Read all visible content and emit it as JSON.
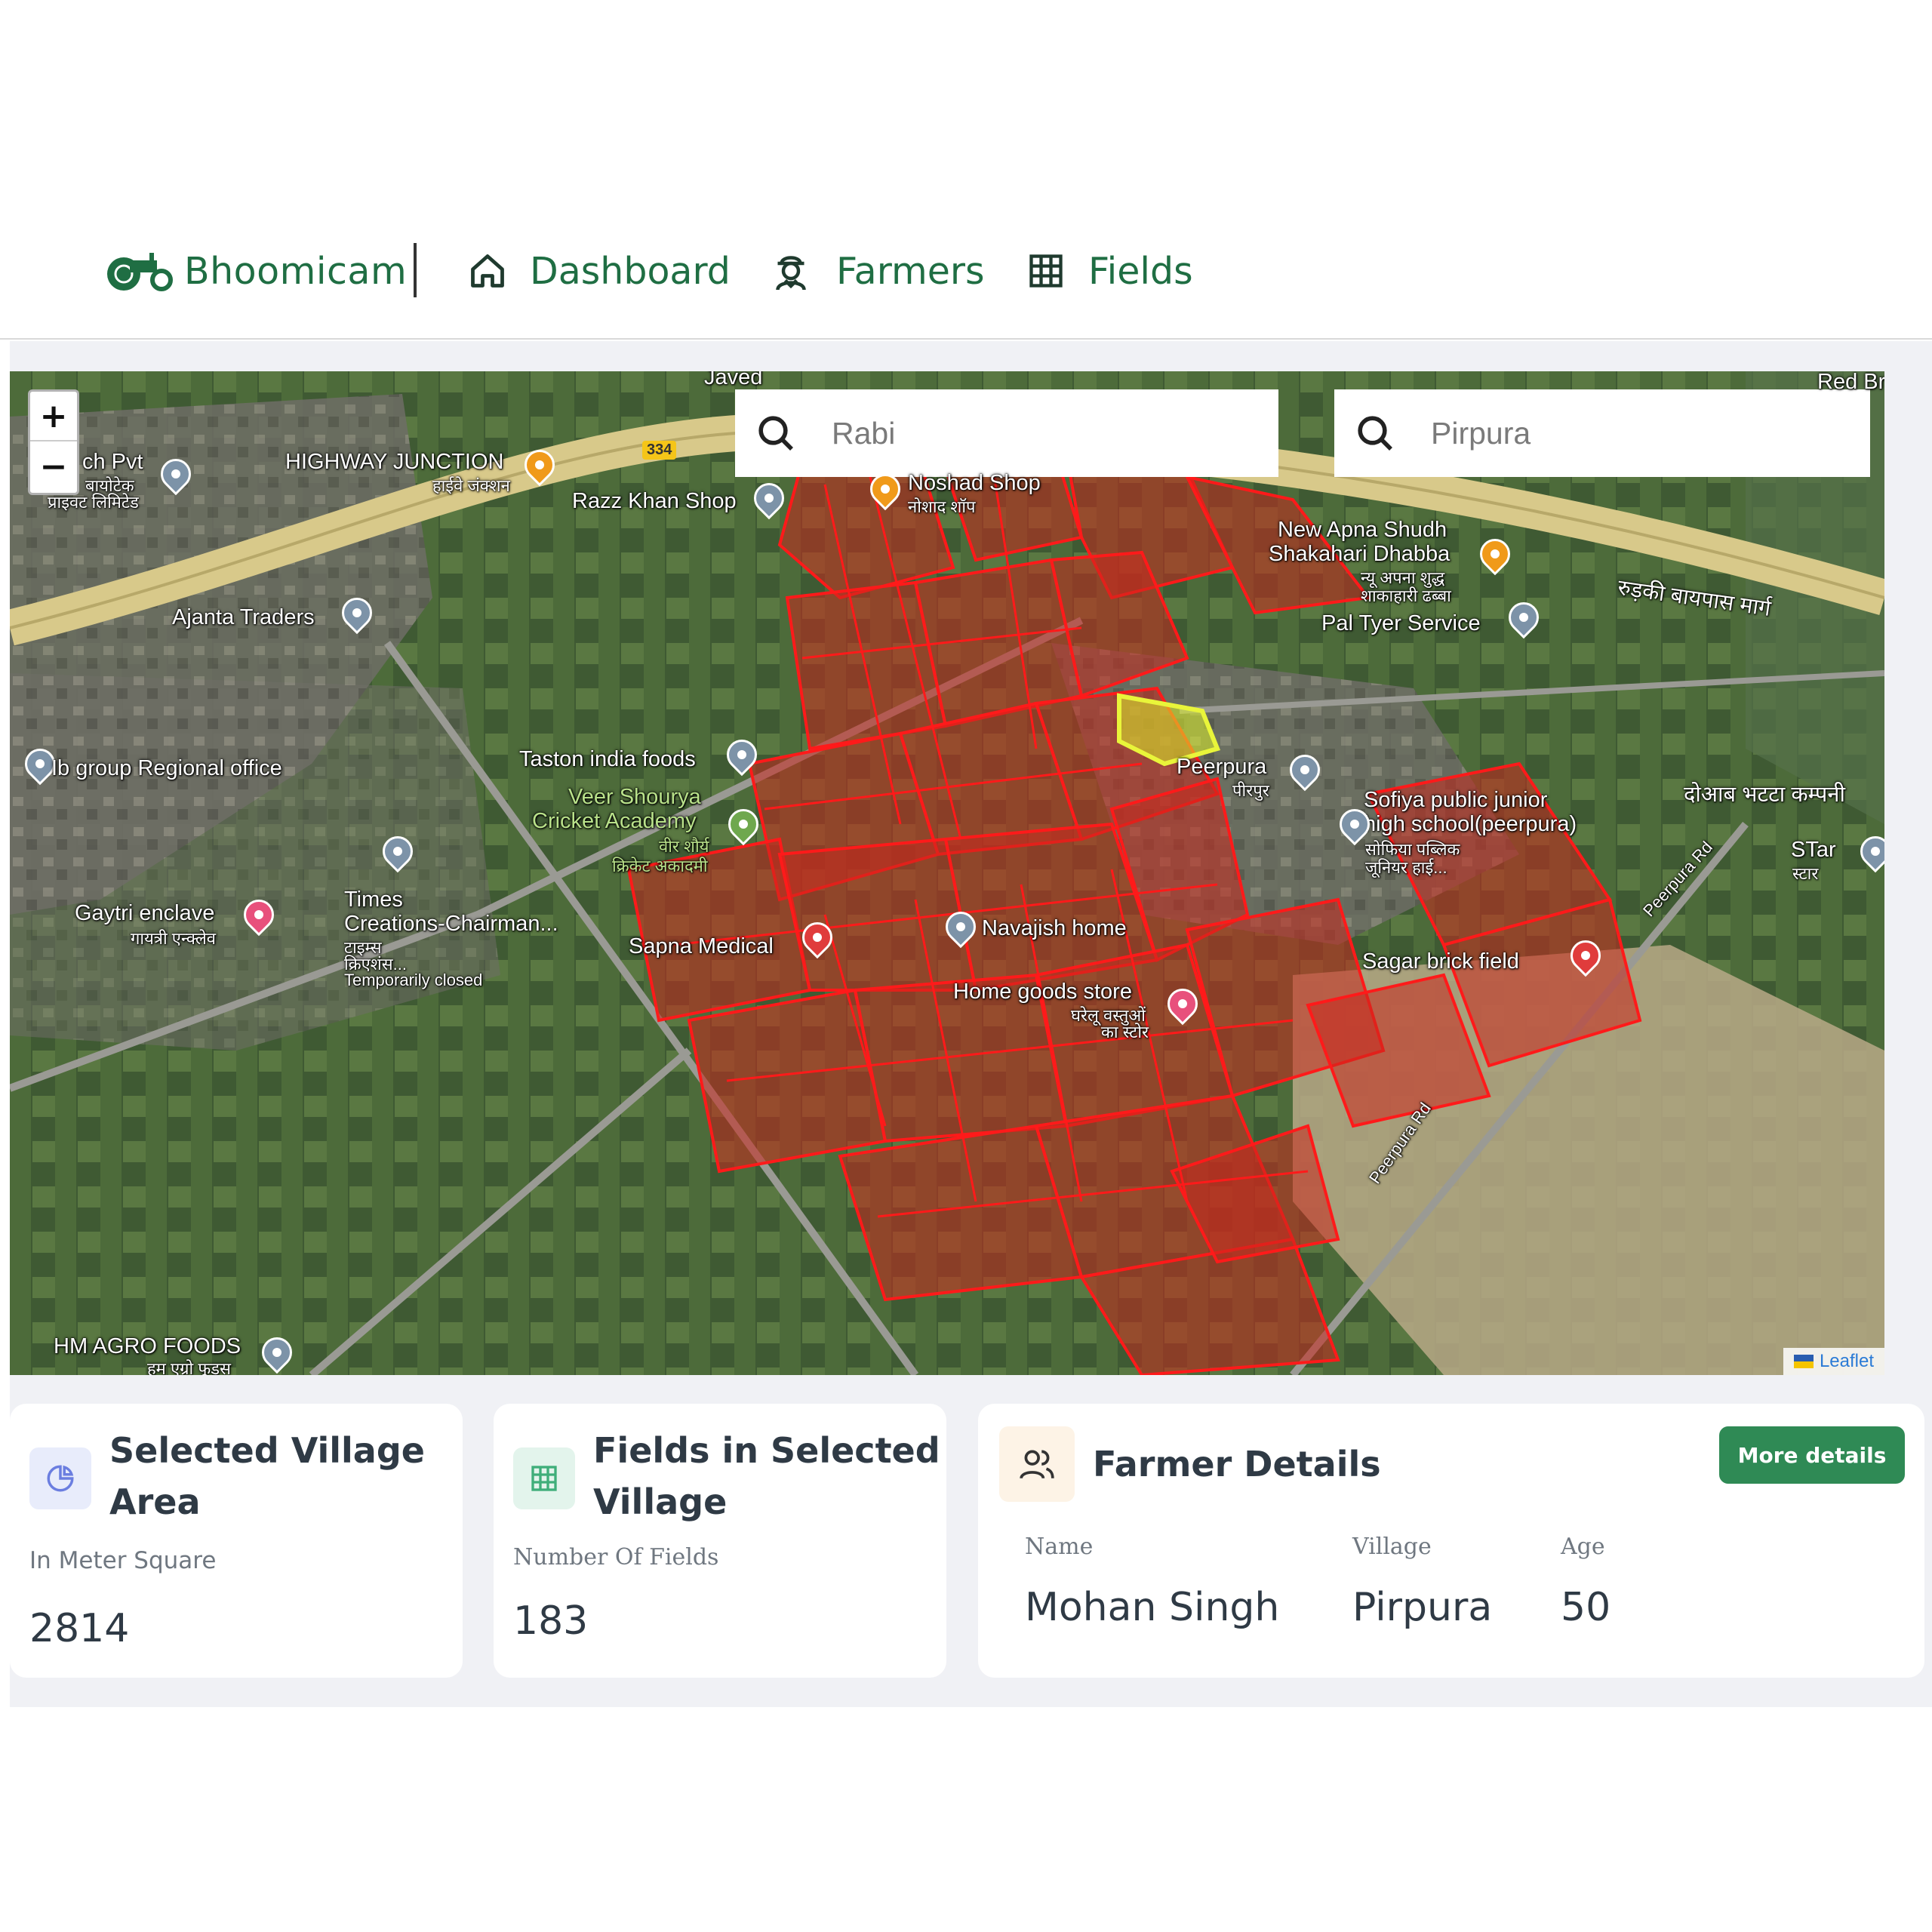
{
  "nav": {
    "brand": "Bhoomicam",
    "items": [
      {
        "label": "Dashboard",
        "icon": "home-icon"
      },
      {
        "label": "Farmers",
        "icon": "farmer-icon"
      },
      {
        "label": "Fields",
        "icon": "grid-icon"
      }
    ]
  },
  "map": {
    "zoom_in": "+",
    "zoom_out": "−",
    "search_season": {
      "value": "",
      "placeholder": "Rabi"
    },
    "search_village": {
      "value": "",
      "placeholder": "Pirpura"
    },
    "attribution": "Leaflet",
    "highway_shield": "334",
    "labels": {
      "javed": "Javed",
      "red_brick": "Red Bri",
      "tech_pvt": "ch Pvt",
      "tech_pvt_hi": "बायोटेक",
      "tech_pvt_hi2": "प्राइवट लिमिटेड",
      "highway_junction": "HIGHWAY JUNCTION",
      "highway_junction_hi": "हाईवे जंक्शन",
      "razz_khan": "Razz Khan Shop",
      "noshad": "Noshad Shop",
      "noshad_hi": "नोशाद शॉप",
      "new_apna": "New Apna Shudh",
      "shakahari": "Shakahari Dhabba",
      "shakahari_hi1": "न्यू अपना शुद्ध",
      "shakahari_hi2": "शाकाहारी ढब्बा",
      "bypass_hi": "रुड़की बायपास मार्ग",
      "ajanta": "Ajanta Traders",
      "pal_tyer": "Pal Tyer Service",
      "taston": "Taston india foods",
      "ib_group": "Ib group Regional office",
      "veer": "Veer Shourya",
      "cricket": "Cricket Academy",
      "cricket_hi1": "वीर शौर्य",
      "cricket_hi2": "क्रिकेट अकादमी",
      "peerpura": "Peerpura",
      "peerpura_hi": "पीरपुर",
      "sofiya1": "Sofiya public junior",
      "sofiya2": "high school(peerpura)",
      "sofiya_hi1": "सोफिया पब्लिक",
      "sofiya_hi2": "जूनियर हाई...",
      "doaab": "दोआब भटटा कम्पनी",
      "peerpura_rd": "Peerpura Rd",
      "star": "STar",
      "star_hi": "स्टार",
      "gaytri": "Gaytri enclave",
      "gaytri_hi": "गायत्री एन्क्लेव",
      "times1": "Times",
      "times2": "Creations-Chairman...",
      "times_hi1": "टाइम्स",
      "times_hi2": "क्रिएशंस...",
      "times_closed": "Temporarily closed",
      "sapna": "Sapna Medical",
      "navajish": "Navajish home",
      "sagar": "Sagar brick field",
      "home_goods": "Home goods store",
      "home_goods_hi1": "घरेलू वस्तुओं",
      "home_goods_hi2": "का स्टोर",
      "peerpura_rd2": "Peerpura Rd",
      "hm_agro": "HM AGRO FOODS",
      "hm_agro_hi": "हम एग्रो फूड्स"
    }
  },
  "cards": {
    "village_area": {
      "title_line1": "Selected Village",
      "title_line2": "Area",
      "subtitle": "In Meter Square",
      "value": "2814"
    },
    "fields": {
      "title_line1": "Fields in Selected",
      "title_line2": "Village",
      "subtitle": "Number Of Fields",
      "value": "183"
    },
    "farmer": {
      "title": "Farmer Details",
      "button": "More details",
      "name_label": "Name",
      "village_label": "Village",
      "age_label": "Age",
      "name": "Mohan Singh",
      "village": "Pirpura",
      "age": "50"
    }
  },
  "colors": {
    "brand_green": "#1f6e43",
    "button_green": "#2f8a55",
    "field_outline": "#ff1a1a",
    "selected_field": "#e9f53a",
    "page_gray": "#f0f1f5"
  }
}
